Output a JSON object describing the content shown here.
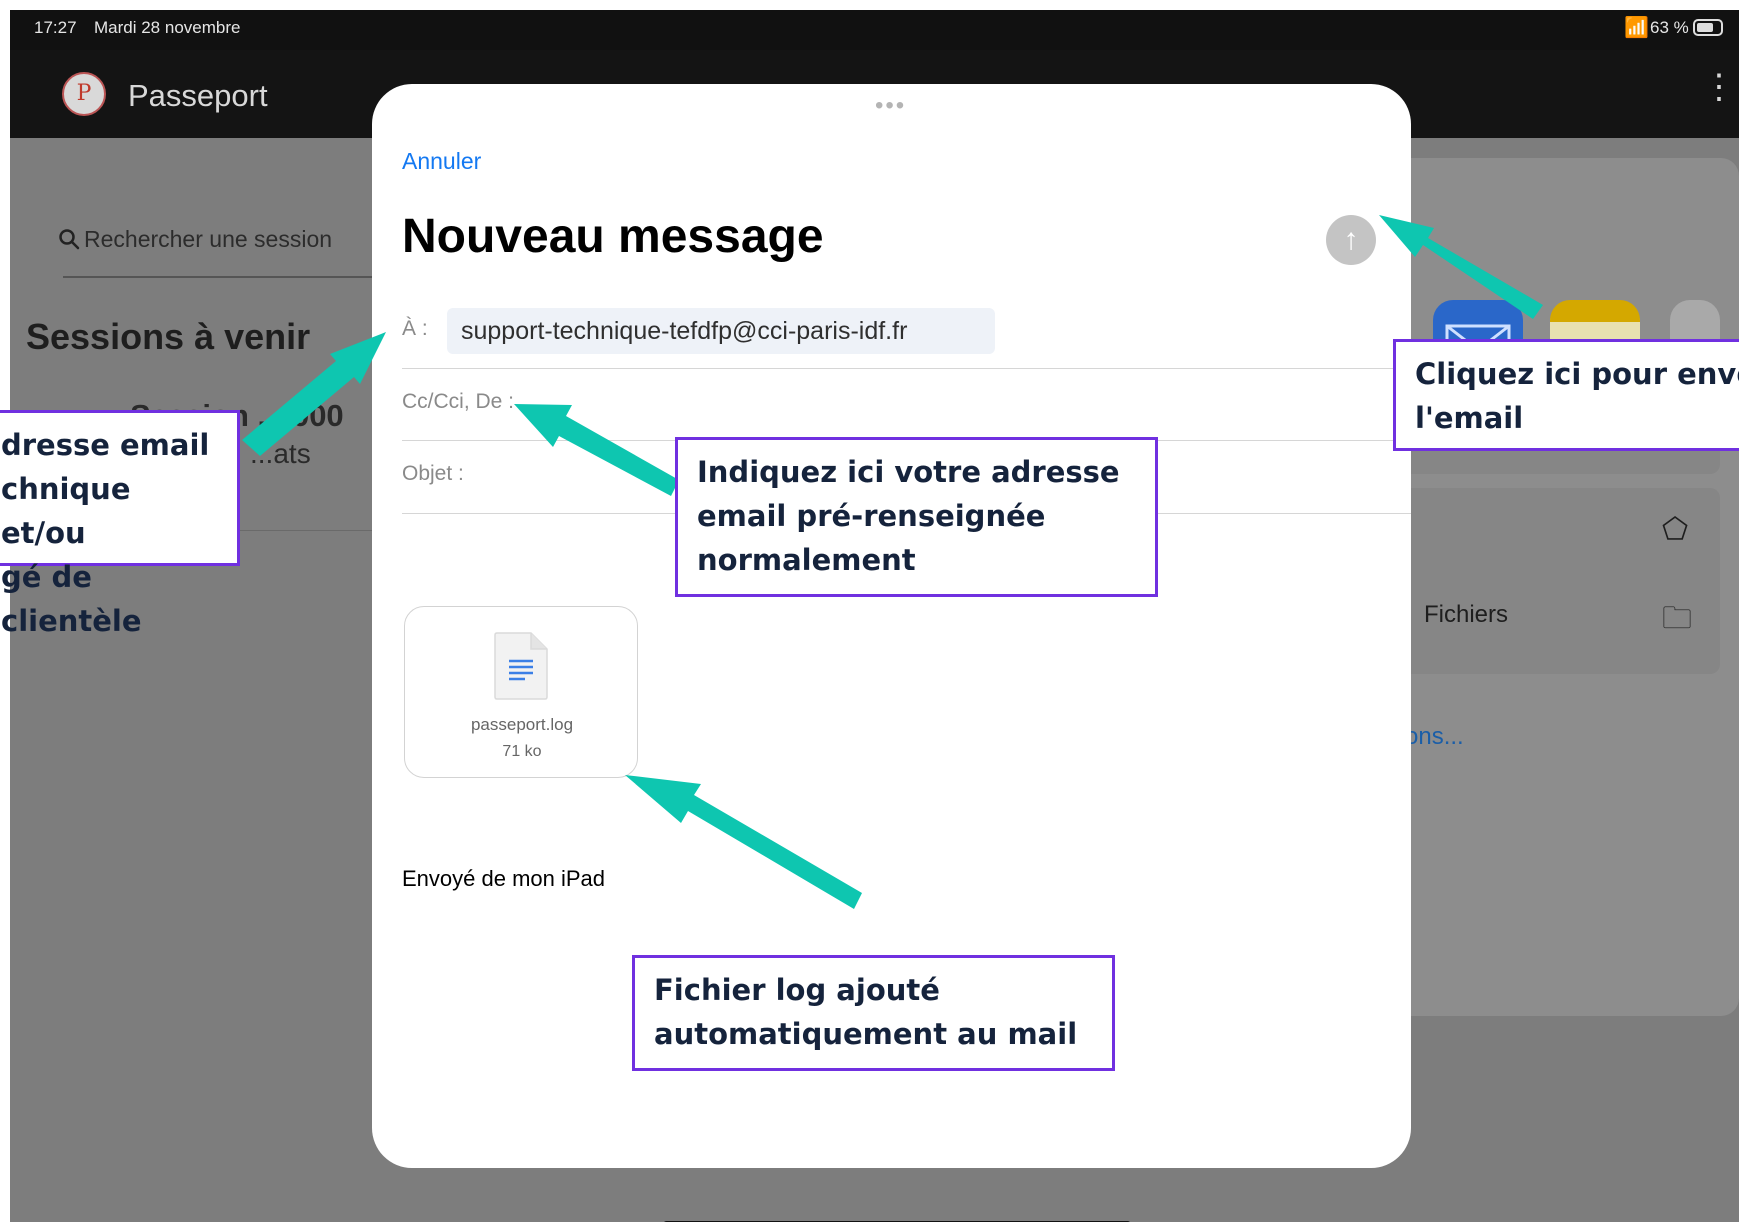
{
  "status_bar": {
    "time": "17:27",
    "date": "Mardi 28 novembre",
    "wifi_icon": "wifi-icon",
    "battery_percent": "63 %",
    "battery_icon": "battery-icon"
  },
  "app_bar": {
    "logo_letter": "P",
    "title": "Passeport",
    "menu_icon": "more-vertical-icon"
  },
  "background_page": {
    "search_placeholder": "Rechercher une session",
    "search_icon": "search-icon",
    "section_title": "Sessions à venir",
    "session_title_partial": "Session ... 000",
    "session_subtitle_partial": "...ats"
  },
  "share_sheet": {
    "files_label": "Fichiers",
    "more_options_partial": "ons...",
    "icons": [
      "copy-icon",
      "tag-icon",
      "folder-icon"
    ]
  },
  "compose": {
    "cancel_label": "Annuler",
    "title": "Nouveau message",
    "send_icon": "arrow-up-icon",
    "to_label": "À :",
    "to_value": "support-technique-tefdfp@cci-paris-idf.fr",
    "cc_label": "Cc/Cci, De :",
    "subject_label": "Objet :",
    "attachment": {
      "name": "passeport.log",
      "size": "71 ko",
      "icon": "document-icon"
    },
    "signature": "Envoyé de mon iPad"
  },
  "annotations": {
    "arrow_color": "#0ec6b0",
    "border_color": "#7030e0",
    "text_color": "#15233c",
    "left_callout": [
      "dresse email",
      "chnique et/ou",
      "gé de clientèle"
    ],
    "from_callout": [
      "Indiquez ici votre adresse",
      "email pré-renseignée",
      "normalement"
    ],
    "attachment_callout": [
      "Fichier log ajouté",
      "automatiquement au mail"
    ],
    "send_callout": [
      "Cliquez ici pour envoy",
      "l'email"
    ]
  }
}
